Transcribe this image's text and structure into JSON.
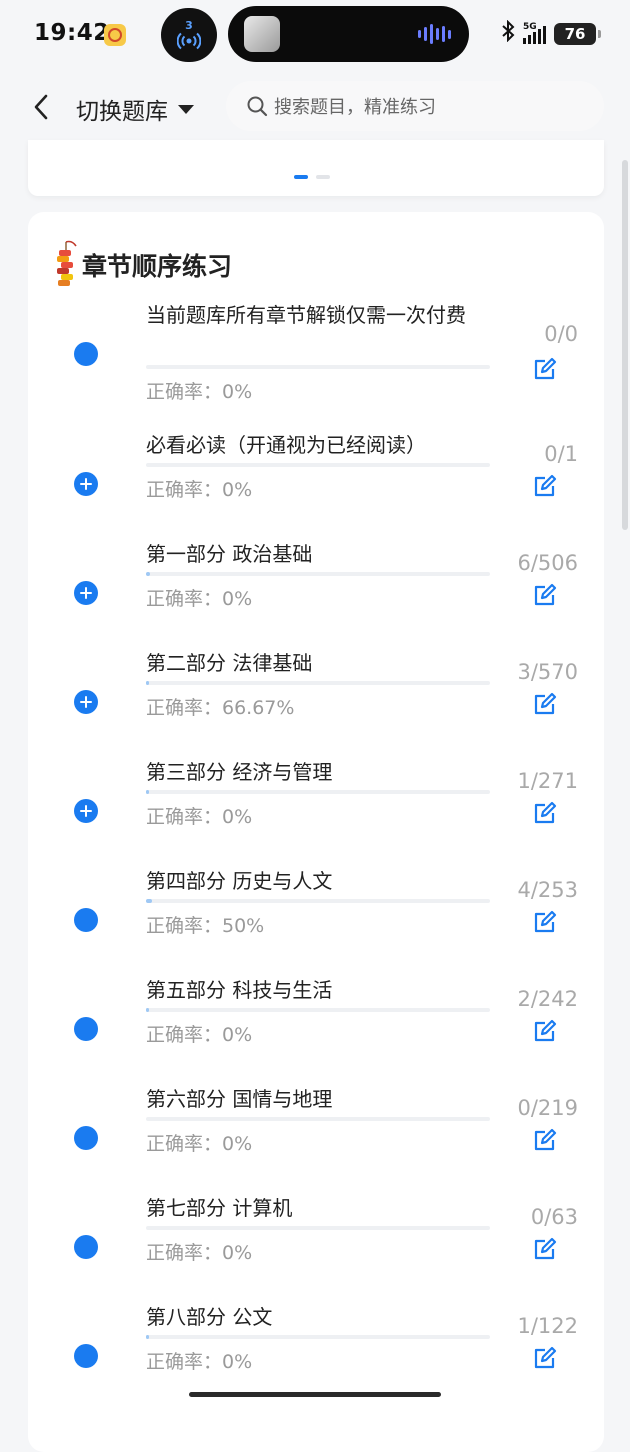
{
  "status_bar": {
    "time": "19:42",
    "cast_number": "3",
    "network": "5G",
    "battery": "76",
    "icons": [
      "app-badge-icon",
      "cast-icon",
      "music-wave-icon",
      "bluetooth-icon",
      "signal-icon",
      "battery-icon"
    ]
  },
  "header": {
    "back_icon": "chevron-left-icon",
    "switch_label": "切换题库",
    "search_placeholder": "搜索题目，精准练习"
  },
  "section": {
    "title": "章节顺序练习",
    "icon": "firecracker-icon"
  },
  "chapters": [
    {
      "title": "当前题库所有章节解锁仅需一次付费",
      "accuracy": "正确率：0%",
      "count": "0/0",
      "icon": "dot",
      "progress": 0
    },
    {
      "title": "必看必读（开通视为已经阅读）",
      "accuracy": "正确率：0%",
      "count": "0/1",
      "icon": "plus",
      "progress": 0
    },
    {
      "title": "第一部分 政治基础",
      "accuracy": "正确率：0%",
      "count": "6/506",
      "icon": "plus",
      "progress": 0.012
    },
    {
      "title": "第二部分 法律基础",
      "accuracy": "正确率：66.67%",
      "count": "3/570",
      "icon": "plus",
      "progress": 0.005
    },
    {
      "title": "第三部分 经济与管理",
      "accuracy": "正确率：0%",
      "count": "1/271",
      "icon": "plus",
      "progress": 0.004
    },
    {
      "title": "第四部分 历史与人文",
      "accuracy": "正确率：50%",
      "count": "4/253",
      "icon": "dot",
      "progress": 0.016
    },
    {
      "title": "第五部分 科技与生活",
      "accuracy": "正确率：0%",
      "count": "2/242",
      "icon": "dot",
      "progress": 0.008
    },
    {
      "title": "第六部分 国情与地理",
      "accuracy": "正确率：0%",
      "count": "0/219",
      "icon": "dot",
      "progress": 0
    },
    {
      "title": "第七部分 计算机",
      "accuracy": "正确率：0%",
      "count": "0/63",
      "icon": "dot",
      "progress": 0
    },
    {
      "title": "第八部分 公文",
      "accuracy": "正确率：0%",
      "count": "1/122",
      "icon": "dot",
      "progress": 0.008
    }
  ],
  "colors": {
    "accent": "#1a7bf0",
    "progress_fill": "#9fc8f4",
    "muted_text": "#9a9a9a",
    "count_text": "#a9a9a9"
  }
}
